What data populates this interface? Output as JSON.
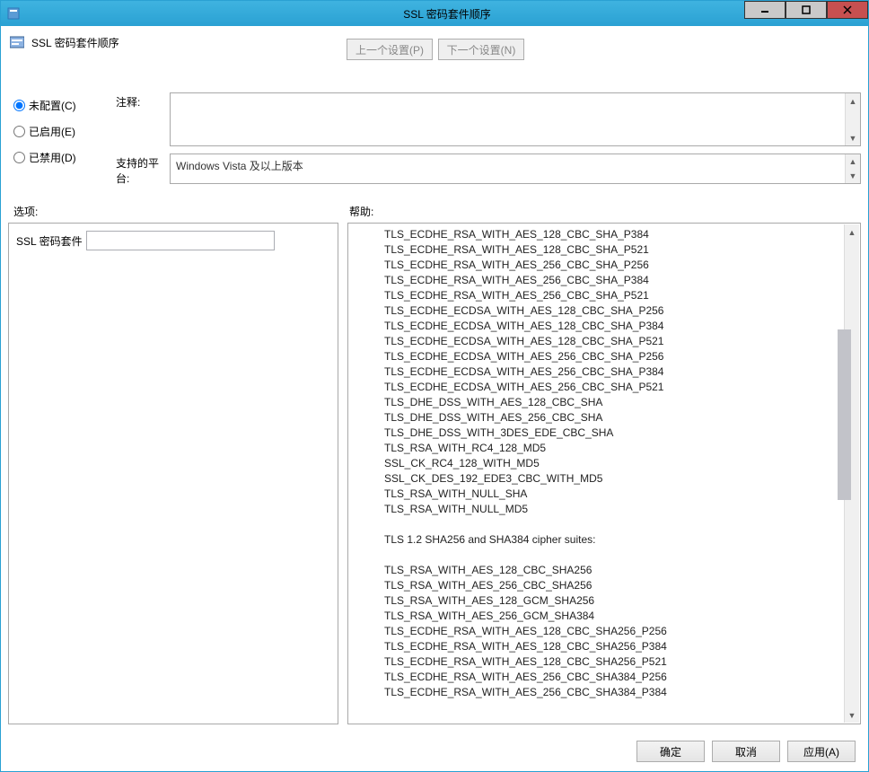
{
  "title": "SSL 密码套件顺序",
  "header_title": "SSL 密码套件顺序",
  "nav": {
    "prev": "上一个设置(P)",
    "next": "下一个设置(N)"
  },
  "radios": {
    "not_configured": "未配置(C)",
    "enabled": "已启用(E)",
    "disabled": "已禁用(D)"
  },
  "fields": {
    "comment_label": "注释:",
    "platform_label": "支持的平台:",
    "platform_value": "Windows Vista 及以上版本"
  },
  "sections": {
    "options": "选项:",
    "help": "帮助:"
  },
  "options_panel": {
    "ssl_suites_label": "SSL 密码套件"
  },
  "help_lines": [
    "TLS_ECDHE_RSA_WITH_AES_128_CBC_SHA_P384",
    "TLS_ECDHE_RSA_WITH_AES_128_CBC_SHA_P521",
    "TLS_ECDHE_RSA_WITH_AES_256_CBC_SHA_P256",
    "TLS_ECDHE_RSA_WITH_AES_256_CBC_SHA_P384",
    "TLS_ECDHE_RSA_WITH_AES_256_CBC_SHA_P521",
    "TLS_ECDHE_ECDSA_WITH_AES_128_CBC_SHA_P256",
    "TLS_ECDHE_ECDSA_WITH_AES_128_CBC_SHA_P384",
    "TLS_ECDHE_ECDSA_WITH_AES_128_CBC_SHA_P521",
    "TLS_ECDHE_ECDSA_WITH_AES_256_CBC_SHA_P256",
    "TLS_ECDHE_ECDSA_WITH_AES_256_CBC_SHA_P384",
    "TLS_ECDHE_ECDSA_WITH_AES_256_CBC_SHA_P521",
    "TLS_DHE_DSS_WITH_AES_128_CBC_SHA",
    "TLS_DHE_DSS_WITH_AES_256_CBC_SHA",
    "TLS_DHE_DSS_WITH_3DES_EDE_CBC_SHA",
    "TLS_RSA_WITH_RC4_128_MD5",
    "SSL_CK_RC4_128_WITH_MD5",
    "SSL_CK_DES_192_EDE3_CBC_WITH_MD5",
    "TLS_RSA_WITH_NULL_SHA",
    "TLS_RSA_WITH_NULL_MD5",
    "",
    "TLS 1.2 SHA256 and SHA384 cipher suites:",
    "",
    "TLS_RSA_WITH_AES_128_CBC_SHA256",
    "TLS_RSA_WITH_AES_256_CBC_SHA256",
    "TLS_RSA_WITH_AES_128_GCM_SHA256",
    "TLS_RSA_WITH_AES_256_GCM_SHA384",
    "TLS_ECDHE_RSA_WITH_AES_128_CBC_SHA256_P256",
    "TLS_ECDHE_RSA_WITH_AES_128_CBC_SHA256_P384",
    "TLS_ECDHE_RSA_WITH_AES_128_CBC_SHA256_P521",
    "TLS_ECDHE_RSA_WITH_AES_256_CBC_SHA384_P256",
    "TLS_ECDHE_RSA_WITH_AES_256_CBC_SHA384_P384"
  ],
  "footer": {
    "ok": "确定",
    "cancel": "取消",
    "apply": "应用(A)"
  }
}
